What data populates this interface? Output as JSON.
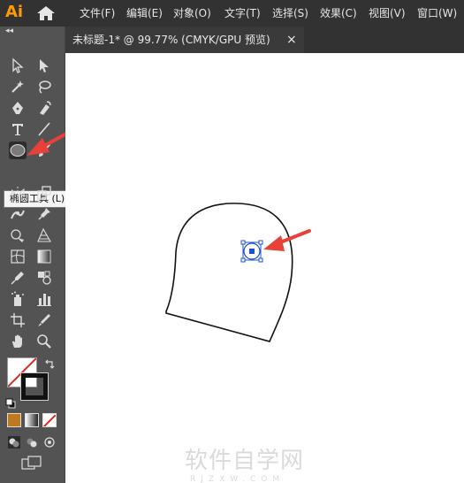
{
  "app": {
    "logo_text": "Ai"
  },
  "menubar": {
    "items": [
      {
        "label": "文件(F)"
      },
      {
        "label": "编辑(E)"
      },
      {
        "label": "对象(O)"
      },
      {
        "label": "文字(T)"
      },
      {
        "label": "选择(S)"
      },
      {
        "label": "效果(C)"
      },
      {
        "label": "视图(V)"
      },
      {
        "label": "窗口(W)"
      }
    ]
  },
  "document": {
    "tab_title": "未标题-1* @ 99.77% (CMYK/GPU 预览)",
    "close_glyph": "×"
  },
  "toolbar": {
    "collapse_glyph": "◂◂",
    "tooltip": "椭圆工具 (L)"
  },
  "watermark": {
    "main": "软件自学网",
    "sub": "RJZXW.COM"
  },
  "colors": {
    "accent": "#ff9a00",
    "selection": "#1a4fd6",
    "arrow": "#e8413a"
  }
}
